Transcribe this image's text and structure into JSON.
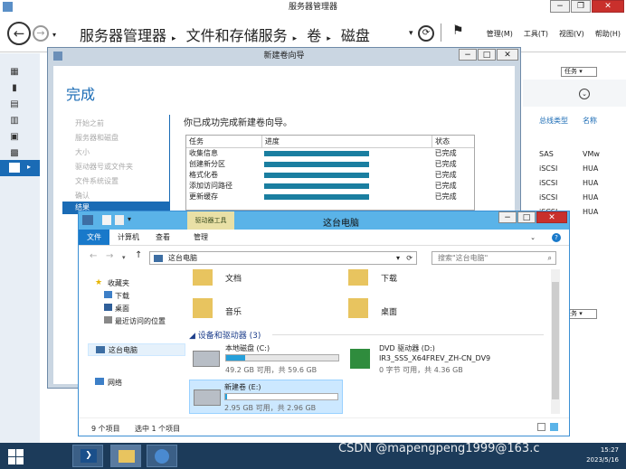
{
  "server_manager": {
    "title": "服务器管理器",
    "breadcrumb": [
      "服务器管理器",
      "文件和存储服务",
      "卷",
      "磁盘"
    ],
    "menu": [
      "管理(M)",
      "工具(T)",
      "视图(V)",
      "帮助(H)"
    ],
    "tasks_label": "任务",
    "right_headers": [
      "总线类型",
      "名称"
    ],
    "right_rows": [
      [
        "SAS",
        "VMw"
      ],
      [
        "iSCSI",
        "HUA"
      ],
      [
        "iSCSI",
        "HUA"
      ],
      [
        "iSCSI",
        "HUA"
      ],
      [
        "iSCSI",
        "HUA"
      ]
    ],
    "tasks_label2": "任务"
  },
  "wizard": {
    "title": "新建卷向导",
    "heading": "完成",
    "steps": [
      "开始之前",
      "服务器和磁盘",
      "大小",
      "驱动器号或文件夹",
      "文件系统设置",
      "确认"
    ],
    "current_step": "结果",
    "message": "你已成功完成新建卷向导。",
    "table_headers": [
      "任务",
      "进度",
      "状态"
    ],
    "rows": [
      {
        "task": "收集信息",
        "status": "已完成",
        "progress": 1
      },
      {
        "task": "创建新分区",
        "status": "已完成",
        "progress": 1
      },
      {
        "task": "格式化卷",
        "status": "已完成",
        "progress": 1
      },
      {
        "task": "添加访问路径",
        "status": "已完成",
        "progress": 1
      },
      {
        "task": "更新缓存",
        "status": "已完成",
        "progress": 1
      }
    ]
  },
  "explorer": {
    "title": "这台电脑",
    "drive_tools": "驱动器工具",
    "ribbon_tabs": [
      "文件",
      "计算机",
      "查看",
      "管理"
    ],
    "address": "这台电脑",
    "search_placeholder": "搜索\"这台电脑\"",
    "nav": {
      "favorites": "收藏夹",
      "fav_items": [
        "下载",
        "桌面",
        "最近访问的位置"
      ],
      "this_pc": "这台电脑",
      "network": "网络"
    },
    "folders": [
      "文档",
      "下载",
      "音乐",
      "桌面"
    ],
    "devices_header": "设备和驱动器 (3)",
    "drives": [
      {
        "name": "本地磁盘 (C:)",
        "info": "49.2 GB 可用，共 59.6 GB",
        "used_fraction": 0.17
      },
      {
        "name": "DVD 驱动器 (D:)",
        "label": "IR3_SSS_X64FREV_ZH-CN_DV9",
        "info": "0 字节 可用，共 4.36 GB"
      },
      {
        "name": "新建卷 (E:)",
        "info": "2.95 GB 可用，共 2.96 GB",
        "used_fraction": 0.003
      }
    ],
    "status_count": "9 个项目",
    "status_selected": "选中 1 个项目"
  },
  "taskbar": {
    "time": "15:27",
    "date": "2023/5/16"
  },
  "watermark": "CSDN @mapengpeng1999@163.c"
}
